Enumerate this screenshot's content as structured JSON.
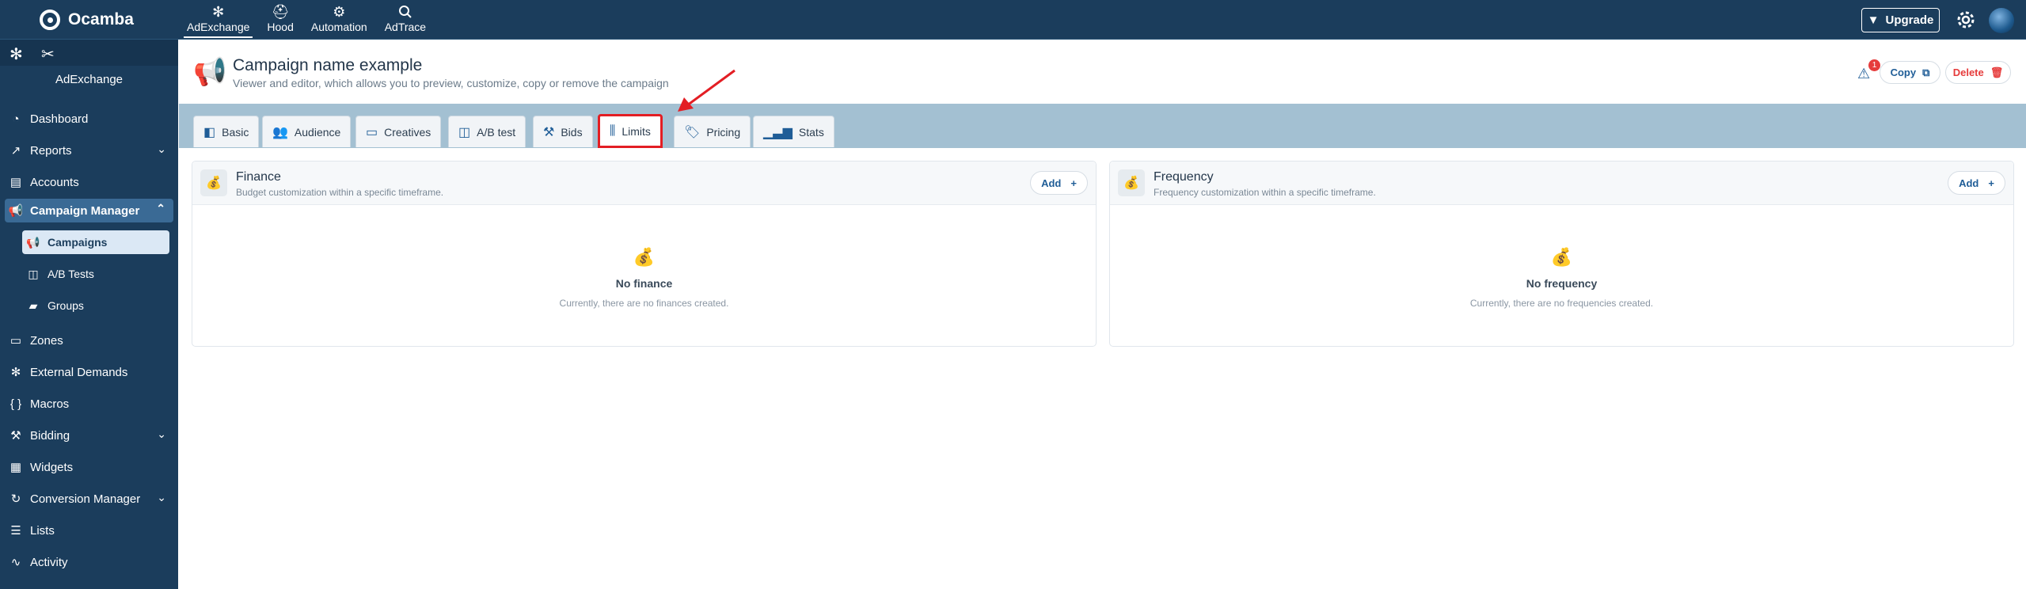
{
  "topbar": {
    "brand": "Ocamba",
    "nav": [
      {
        "label": "AdExchange",
        "icon": "asterisk-icon",
        "active": true
      },
      {
        "label": "Hood",
        "icon": "hood-icon",
        "active": false
      },
      {
        "label": "Automation",
        "icon": "automation-icon",
        "active": false
      },
      {
        "label": "AdTrace",
        "icon": "search-icon",
        "active": false
      }
    ],
    "upgrade_label": "Upgrade"
  },
  "sidebar": {
    "title": "AdExchange",
    "items": [
      {
        "label": "Dashboard",
        "icon": "dashboard-icon"
      },
      {
        "label": "Reports",
        "icon": "reports-icon",
        "expandable": true
      },
      {
        "label": "Accounts",
        "icon": "accounts-icon"
      },
      {
        "label": "Campaign Manager",
        "icon": "megaphone-icon",
        "expanded": true
      },
      {
        "label": "Zones",
        "icon": "zones-icon"
      },
      {
        "label": "External Demands",
        "icon": "external-demands-icon"
      },
      {
        "label": "Macros",
        "icon": "braces-icon"
      },
      {
        "label": "Bidding",
        "icon": "gavel-icon",
        "expandable": true
      },
      {
        "label": "Widgets",
        "icon": "widgets-icon"
      },
      {
        "label": "Conversion Manager",
        "icon": "conversion-icon",
        "expandable": true
      },
      {
        "label": "Lists",
        "icon": "lists-icon"
      },
      {
        "label": "Activity",
        "icon": "activity-icon"
      }
    ],
    "sub_items": [
      {
        "label": "Campaigns",
        "icon": "megaphone-icon",
        "active": true
      },
      {
        "label": "A/B Tests",
        "icon": "ab-test-icon"
      },
      {
        "label": "Groups",
        "icon": "folder-icon"
      }
    ]
  },
  "header": {
    "title": "Campaign name example",
    "subtitle": "Viewer and editor, which allows you to preview, customize, copy or remove the campaign",
    "warning_count": "1",
    "copy_label": "Copy",
    "delete_label": "Delete"
  },
  "tabs": [
    {
      "label": "Basic",
      "icon": "basic-icon"
    },
    {
      "label": "Audience",
      "icon": "audience-icon"
    },
    {
      "label": "Creatives",
      "icon": "creatives-icon"
    },
    {
      "label": "A/B test",
      "icon": "ab-test-icon"
    },
    {
      "label": "Bids",
      "icon": "gavel-icon"
    },
    {
      "label": "Limits",
      "icon": "sliders-icon",
      "active": true
    },
    {
      "label": "Pricing",
      "icon": "price-tag-icon"
    },
    {
      "label": "Stats",
      "icon": "chart-icon"
    }
  ],
  "finance": {
    "title": "Finance",
    "subtitle": "Budget customization within a specific timeframe.",
    "add_label": "Add",
    "empty_title": "No finance",
    "empty_sub": "Currently, there are no finances created."
  },
  "frequency": {
    "title": "Frequency",
    "subtitle": "Frequency customization within a specific timeframe.",
    "add_label": "Add",
    "empty_title": "No frequency",
    "empty_sub": "Currently, there are no frequencies created."
  },
  "colors": {
    "nav_bg": "#1b3d5c",
    "accent": "#1f5d97",
    "tab_strip": "#a3c0d2",
    "highlight": "#e31e24",
    "danger": "#e63c3c"
  }
}
